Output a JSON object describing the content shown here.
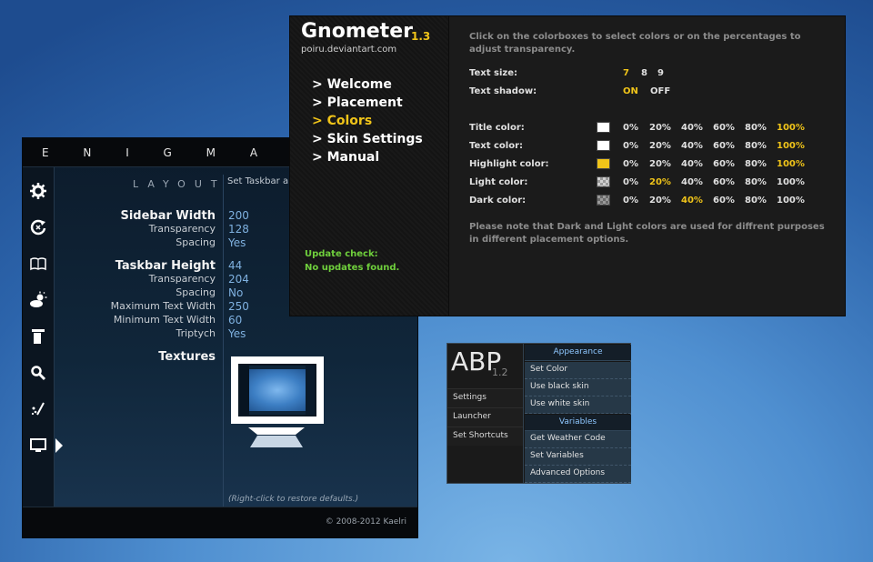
{
  "enigma": {
    "title": "E N I G M A",
    "section": "LAYOUT",
    "description": "Set Taskbar and Sidebar size, position, textures in your stylesheet",
    "sidebar_width_label": "Sidebar Width",
    "sidebar_width_value": "200",
    "sidebar_transparency_label": "Transparency",
    "sidebar_transparency_value": "128",
    "sidebar_spacing_label": "Spacing",
    "sidebar_spacing_value": "Yes",
    "taskbar_height_label": "Taskbar Height",
    "taskbar_height_value": "44",
    "taskbar_transparency_label": "Transparency",
    "taskbar_transparency_value": "204",
    "taskbar_spacing_label": "Spacing",
    "taskbar_spacing_value": "No",
    "max_text_width_label": "Maximum Text Width",
    "max_text_width_value": "250",
    "min_text_width_label": "Minimum Text Width",
    "min_text_width_value": "60",
    "triptych_label": "Triptych",
    "triptych_value": "Yes",
    "textures_label": "Textures",
    "restore_hint": "(Right-click to restore defaults.)",
    "copyright": "© 2008-2012 Kaelri",
    "sidebar_icons": [
      "gear-icon",
      "refresh-icon",
      "book-icon",
      "weather-icon",
      "panel-icon",
      "search-icon",
      "tools-icon",
      "monitor-icon"
    ]
  },
  "gnometer": {
    "name": "Gnometer",
    "version": "1.3",
    "url": "poiru.deviantart.com",
    "menu": [
      "> Welcome",
      "> Placement",
      "> Colors",
      "> Skin Settings",
      "> Manual"
    ],
    "active_menu": "> Colors",
    "update_title": "Update check:",
    "update_status": "No updates found.",
    "intro": "Click on the colorboxes to select colors or on the percentages to adjust transparency.",
    "text_size_label": "Text size:",
    "text_sizes": [
      "7",
      "8",
      "9"
    ],
    "text_size_selected": "7",
    "text_shadow_label": "Text shadow:",
    "shadow_on": "ON",
    "shadow_off": "OFF",
    "shadow_selected": "ON",
    "percentages": [
      "0%",
      "20%",
      "40%",
      "60%",
      "80%",
      "100%"
    ],
    "color_rows": [
      {
        "label": "Title color:",
        "swatch": "#ffffff",
        "selected": "100%"
      },
      {
        "label": "Text color:",
        "swatch": "#ffffff",
        "selected": "100%"
      },
      {
        "label": "Highlight color:",
        "swatch": "#f0c419",
        "selected": "100%"
      },
      {
        "label": "Light color:",
        "swatch": "checker",
        "selected": "20%"
      },
      {
        "label": "Dark color:",
        "swatch": "checker",
        "selected": "40%"
      }
    ],
    "note": "Please note that Dark and Light colors are used for diffrent purposes in different placement options.",
    "accent": "#f0c419"
  },
  "abp": {
    "logo": "ABP",
    "version": "1.2",
    "left_buttons": [
      "Settings",
      "Launcher",
      "Set Shortcuts"
    ],
    "appearance_header": "Appearance",
    "appearance_items": [
      "Set Color",
      "Use black skin",
      "Use white skin"
    ],
    "variables_header": "Variables",
    "variables_items": [
      "Get Weather Code",
      "Set Variables",
      "Advanced Options"
    ]
  }
}
